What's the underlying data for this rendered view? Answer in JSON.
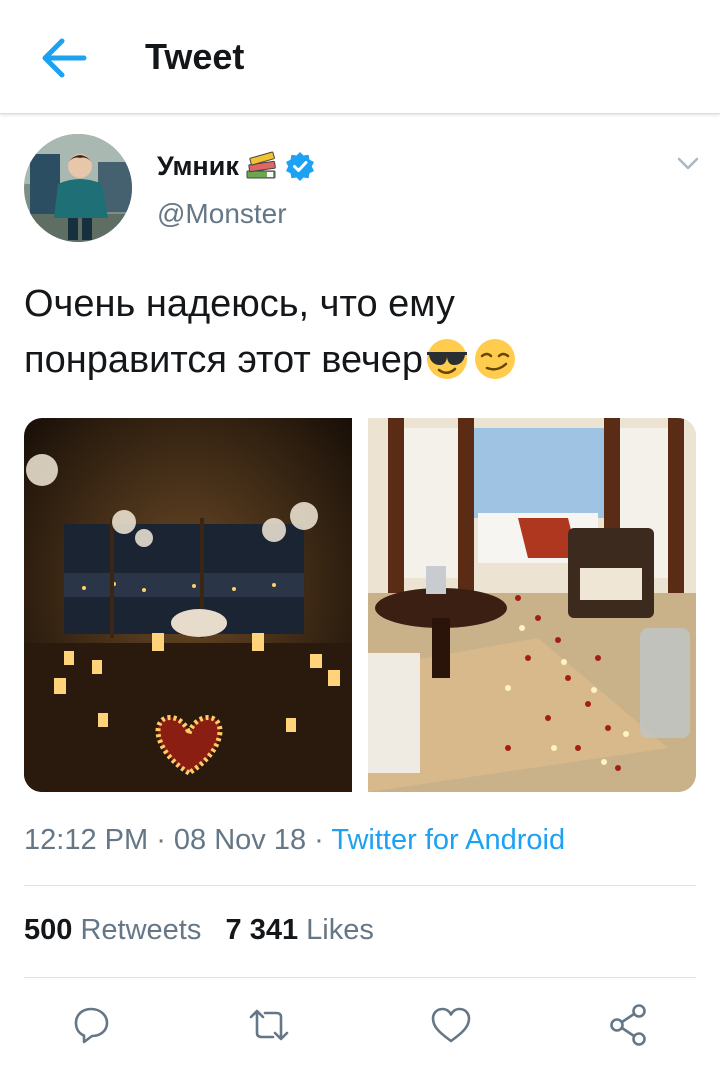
{
  "header": {
    "title": "Tweet",
    "back_icon": "arrow-left-icon",
    "accent": "#1da1f2"
  },
  "author": {
    "display_name": "Умник",
    "name_emoji": "books-emoji",
    "verified": true,
    "handle": "@Monster"
  },
  "tweet": {
    "line1": "Очень надеюсь, что ему",
    "line2": "понравится этот вечер",
    "trailing_emojis": [
      "sunglasses-emoji",
      "smirk-emoji"
    ]
  },
  "media": [
    {
      "name": "candle-heart-room-photo"
    },
    {
      "name": "rose-petal-bedroom-photo"
    }
  ],
  "meta": {
    "time": "12:12 PM",
    "sep1": " · ",
    "date": "08 Nov 18",
    "sep2": " · ",
    "source": "Twitter for Android"
  },
  "stats": {
    "retweets_count": "500",
    "retweets_label": "Retweets",
    "likes_count": "7 341",
    "likes_label": "Likes"
  },
  "actions": [
    "reply-icon",
    "retweet-icon",
    "like-icon",
    "share-icon"
  ],
  "colors": {
    "text": "#14171a",
    "secondary": "#657786",
    "link": "#1da1f2",
    "divider": "#dfe3e6"
  }
}
